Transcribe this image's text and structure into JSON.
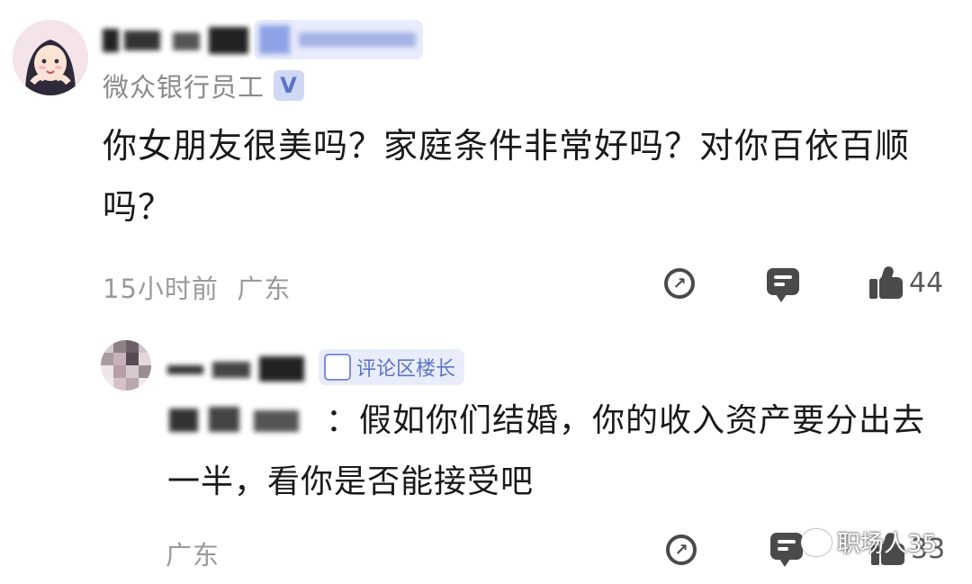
{
  "comment": {
    "author_role": "微众银行员工",
    "verified_badge": "V",
    "text": "你女朋友很美吗？家庭条件非常好吗？对你百依百顺吗？",
    "time": "15小时前",
    "location": "广东",
    "likes": "44",
    "icons": {
      "share": "share-icon",
      "reply": "comment-icon",
      "like": "thumbs-up-icon"
    }
  },
  "reply": {
    "badge_label": "评论区楼长",
    "text": "：假如你们结婚，你的收入资产要分出去一半，看你是否能接受吧",
    "location": "广东",
    "likes": "33"
  },
  "watermark": {
    "text": "职场人35"
  }
}
